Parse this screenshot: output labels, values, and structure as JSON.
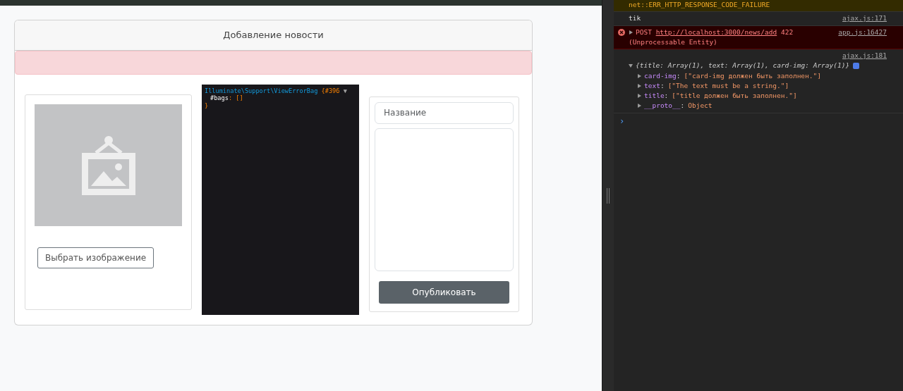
{
  "page": {
    "card_title": "Добавление новости",
    "alert": {
      "kind": "danger"
    },
    "image_panel": {
      "button": "Выбрать изображение"
    },
    "dump": {
      "class_name": "Illuminate\\Support\\ViewErrorBag",
      "object_id": "{#396",
      "toggle": "▼",
      "property": "#bags",
      "separator": ":",
      "value": "[]",
      "closing": "}"
    },
    "form": {
      "title_placeholder": "Название",
      "submit": "Опубликовать"
    }
  },
  "console": {
    "messages": [
      {
        "kind": "warning",
        "text": "net::ERR_HTTP_RESPONSE_CODE_FAILURE"
      },
      {
        "kind": "log",
        "text": "tik",
        "source": "ajax.js:171"
      },
      {
        "kind": "error",
        "expanded": false,
        "method": "POST",
        "url": "http://localhost:3000/news/add",
        "status": "422",
        "status_text": "(Unprocessable Entity)",
        "source": "app.js:16427"
      },
      {
        "kind": "object",
        "expanded": true,
        "source": "ajax.js:181",
        "summary": "{title: Array(1), text: Array(1), card-img: Array(1)}",
        "properties": [
          {
            "key": "card-img",
            "separator": ":",
            "value": "[\"card-img должен быть заполнен.\"]",
            "expanded": false
          },
          {
            "key": "text",
            "separator": ":",
            "value": "[\"The text must be a string.\"]",
            "expanded": false
          },
          {
            "key": "title",
            "separator": ":",
            "value": "[\"title должен быть заполнен.\"]",
            "expanded": false
          },
          {
            "key": "__proto__",
            "separator": ":",
            "value": "Object",
            "expanded": false
          }
        ]
      }
    ],
    "prompt": "›"
  }
}
